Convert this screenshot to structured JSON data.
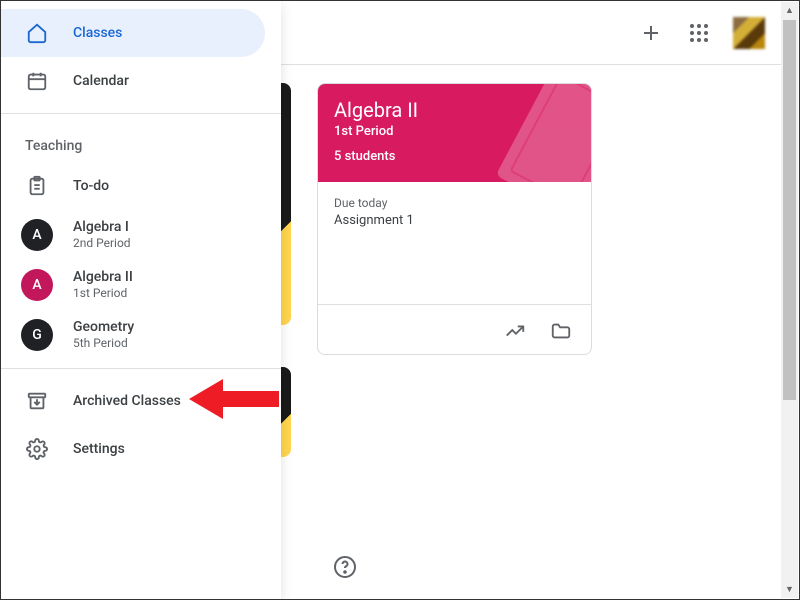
{
  "sidebar": {
    "classes": "Classes",
    "calendar": "Calendar",
    "section_label": "Teaching",
    "todo": "To-do",
    "archived": "Archived Classes",
    "settings": "Settings",
    "items": [
      {
        "initial": "A",
        "name": "Algebra I",
        "sub": "2nd Period",
        "color": "#202124"
      },
      {
        "initial": "A",
        "name": "Algebra II",
        "sub": "1st Period",
        "color": "#c2185b"
      },
      {
        "initial": "G",
        "name": "Geometry",
        "sub": "5th Period",
        "color": "#202124"
      }
    ]
  },
  "card": {
    "title": "Algebra II",
    "sub": "1st Period",
    "students": "5 students",
    "due_label": "Due today",
    "due_item": "Assignment 1"
  }
}
